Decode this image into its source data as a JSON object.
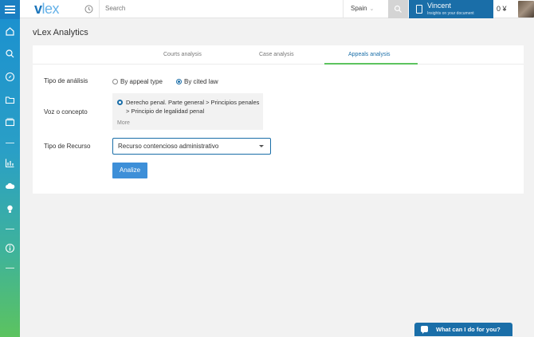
{
  "app": {
    "title": "vLex Analytics"
  },
  "topbar": {
    "logo_v": "v",
    "logo_rest": "lex",
    "search_placeholder": "Search",
    "country": "Spain",
    "user_name": "Vincent",
    "user_subtitle": "Insights on your document",
    "credits": "0 ¥"
  },
  "sidebar": {
    "icons": [
      "home-icon",
      "search-icon",
      "compass-icon",
      "folder-icon",
      "stack-icon",
      "chart-icon",
      "cloud-icon",
      "lightbulb-icon",
      "info-icon"
    ]
  },
  "tabs": [
    {
      "label": "Courts analysis",
      "active": false
    },
    {
      "label": "Case analysis",
      "active": false
    },
    {
      "label": "Appeals analysis",
      "active": true
    }
  ],
  "form": {
    "analysis_type_label": "Tipo de análisis",
    "option_appeal_type": "By appeal type",
    "option_cited_law": "By cited law",
    "selected_option": "By cited law",
    "concept_label": "Voz o concepto",
    "concept_value": "Derecho penal. Parte general > Principios penales > Principio de legalidad penal",
    "concept_more": "More",
    "recurso_label": "Tipo de Recurso",
    "recurso_value": "Recurso contencioso administrativo",
    "submit_label": "Analize"
  },
  "chat": {
    "label": "What can I do for you?"
  },
  "colors": {
    "brand": "#1a6ea8",
    "accent_green": "#5cc35f",
    "button": "#3d8fd8"
  }
}
